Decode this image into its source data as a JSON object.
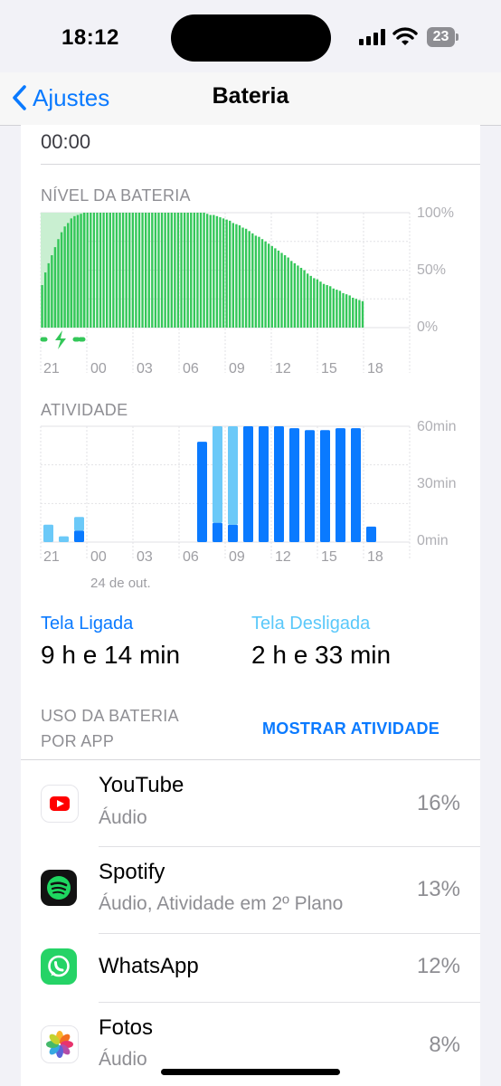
{
  "status": {
    "time": "18:12",
    "battery_level": "23"
  },
  "nav": {
    "back_label": "Ajustes",
    "title": "Bateria"
  },
  "top_row_value": "00:00",
  "chart_data": [
    {
      "type": "bar",
      "title": "NÍVEL DA BATERIA",
      "ylim": [
        0,
        100
      ],
      "y_ticks": [
        "100%",
        "50%",
        "0%"
      ],
      "x_ticks": [
        "21",
        "00",
        "03",
        "06",
        "09",
        "12",
        "15",
        "18"
      ],
      "charging_indicator": "charging-icon",
      "grid": true,
      "values": [
        37,
        48,
        56,
        63,
        70,
        77,
        83,
        88,
        91,
        95,
        97,
        98,
        99,
        100,
        100,
        100,
        100,
        100,
        100,
        100,
        100,
        100,
        100,
        100,
        100,
        100,
        100,
        100,
        100,
        100,
        100,
        100,
        100,
        100,
        100,
        100,
        100,
        100,
        100,
        100,
        100,
        100,
        100,
        100,
        100,
        100,
        100,
        100,
        100,
        100,
        100,
        99,
        98,
        98,
        97,
        96,
        95,
        94,
        93,
        91,
        90,
        89,
        87,
        86,
        84,
        82,
        80,
        79,
        77,
        75,
        73,
        71,
        69,
        67,
        65,
        63,
        61,
        58,
        56,
        54,
        52,
        50,
        47,
        45,
        43,
        42,
        40,
        38,
        37,
        36,
        34,
        33,
        32,
        30,
        29,
        28,
        26,
        25,
        24,
        23
      ],
      "colors": {
        "bar": "#34c759",
        "charging_highlight": "#c9efd1"
      }
    },
    {
      "type": "bar",
      "title": "ATIVIDADE",
      "ylim": [
        0,
        60
      ],
      "y_ticks": [
        "60min",
        "30min",
        "0min"
      ],
      "x_ticks": [
        "21",
        "00",
        "03",
        "06",
        "09",
        "12",
        "15",
        "18"
      ],
      "date_label": "24 de out.",
      "grid": true,
      "categories": [
        "21h",
        "22h",
        "23h",
        "00h",
        "01h",
        "02h",
        "03h",
        "04h",
        "05h",
        "06h",
        "07h",
        "08h",
        "09h",
        "10h",
        "11h",
        "12h",
        "13h",
        "14h",
        "15h",
        "16h",
        "17h",
        "18h"
      ],
      "series": [
        {
          "name": "Tela Ligada",
          "values": [
            0,
            0,
            6,
            0,
            0,
            0,
            0,
            0,
            0,
            0,
            52,
            10,
            9,
            60,
            60,
            60,
            59,
            58,
            58,
            59,
            59,
            8
          ]
        },
        {
          "name": "Tela Desligada",
          "values": [
            9,
            3,
            7,
            0,
            0,
            0,
            0,
            0,
            0,
            0,
            0,
            50,
            51,
            0,
            0,
            0,
            0,
            0,
            0,
            0,
            0,
            0
          ]
        }
      ],
      "colors": {
        "on": "#0a7aff",
        "off": "#6bc9f8"
      }
    }
  ],
  "legend": {
    "on_label": "Tela Ligada",
    "on_value": "9 h e 14 min",
    "on_color": "#0a7aff",
    "off_label": "Tela Desligada",
    "off_value": "2 h e 33 min",
    "off_color": "#5ac8fa"
  },
  "usage": {
    "label_line1": "USO DA BATERIA",
    "label_line2": "POR APP",
    "show_activity": "MOSTRAR ATIVIDADE"
  },
  "apps": [
    {
      "name": "YouTube",
      "subtitle": "Áudio",
      "percent": "16%",
      "icon": "youtube-icon"
    },
    {
      "name": "Spotify",
      "subtitle": "Áudio, Atividade em 2º Plano",
      "percent": "13%",
      "icon": "spotify-icon"
    },
    {
      "name": "WhatsApp",
      "subtitle": "",
      "percent": "12%",
      "icon": "whatsapp-icon"
    },
    {
      "name": "Fotos",
      "subtitle": "Áudio",
      "percent": "8%",
      "icon": "photos-icon"
    }
  ]
}
